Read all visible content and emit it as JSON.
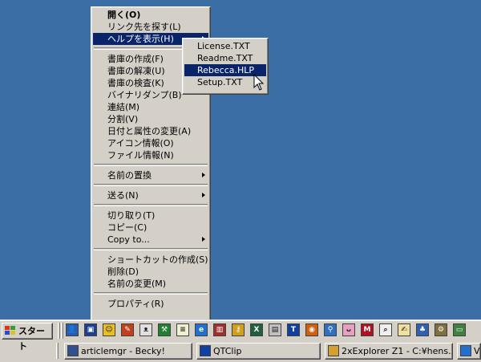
{
  "context_menu": {
    "items": [
      {
        "label": "開く(O)",
        "bold": true
      },
      {
        "label": "リンク先を探す(L)"
      },
      {
        "label": "ヘルプを表示(H)",
        "submenu": true,
        "selected": true
      },
      {
        "separator": true
      },
      {
        "label": "書庫の作成(F)"
      },
      {
        "label": "書庫の解凍(U)"
      },
      {
        "label": "書庫の検査(K)"
      },
      {
        "label": "バイナリダンプ(B)"
      },
      {
        "label": "連結(M)"
      },
      {
        "label": "分割(V)"
      },
      {
        "label": "日付と属性の変更(A)"
      },
      {
        "label": "アイコン情報(O)"
      },
      {
        "label": "ファイル情報(N)"
      },
      {
        "separator": true
      },
      {
        "label": "名前の置換",
        "submenu": true
      },
      {
        "separator": true
      },
      {
        "label": "送る(N)",
        "submenu": true
      },
      {
        "separator": true
      },
      {
        "label": "切り取り(T)"
      },
      {
        "label": "コピー(C)"
      },
      {
        "label": "Copy to...",
        "submenu": true
      },
      {
        "separator": true
      },
      {
        "label": "ショートカットの作成(S)"
      },
      {
        "label": "削除(D)"
      },
      {
        "label": "名前の変更(M)"
      },
      {
        "separator": true
      },
      {
        "label": "プロパティ(R)"
      }
    ]
  },
  "help_submenu": {
    "items": [
      {
        "label": "License.TXT"
      },
      {
        "label": "Readme.TXT"
      },
      {
        "label": "Rebecca.HLP",
        "selected": true
      },
      {
        "label": "Setup.TXT"
      }
    ]
  },
  "taskbar": {
    "start_label": "スタート",
    "quick_launch": [
      {
        "icon": "user-icon",
        "color": "#2a5db0",
        "glyph": "👤"
      },
      {
        "icon": "computer-icon",
        "color": "#1c3f94",
        "glyph": "▣"
      },
      {
        "icon": "smiley-icon",
        "color": "#e8c020",
        "glyph": "☺"
      },
      {
        "icon": "paint-icon",
        "color": "#c04020",
        "glyph": "✎"
      },
      {
        "icon": "cat-icon",
        "color": "#e0e0e0",
        "glyph": "ᴥ"
      },
      {
        "icon": "tool-icon",
        "color": "#208030",
        "glyph": "⚒"
      },
      {
        "icon": "notepad-icon",
        "color": "#f0f0d0",
        "glyph": "≡"
      },
      {
        "icon": "ie-icon",
        "color": "#2070d0",
        "glyph": "e"
      },
      {
        "icon": "books-icon",
        "color": "#a03030",
        "glyph": "▥"
      },
      {
        "icon": "key-icon",
        "color": "#d0a020",
        "glyph": "⚷"
      },
      {
        "icon": "x-icon",
        "color": "#206040",
        "glyph": "X"
      },
      {
        "icon": "clipboard-icon",
        "color": "#c0c0c0",
        "glyph": "▤"
      },
      {
        "icon": "t-icon",
        "color": "#1040a0",
        "glyph": "T"
      },
      {
        "icon": "media-icon",
        "color": "#d06010",
        "glyph": "◉"
      },
      {
        "icon": "search-icon",
        "color": "#3070c0",
        "glyph": "⚲"
      },
      {
        "icon": "cow-icon",
        "color": "#e8a0c0",
        "glyph": "ᴗ"
      },
      {
        "icon": "m-icon",
        "color": "#b01020",
        "glyph": "M"
      },
      {
        "icon": "find-icon",
        "color": "#f0f0f0",
        "glyph": "⌕"
      },
      {
        "icon": "edit-icon",
        "color": "#f0e0a0",
        "glyph": "✍"
      },
      {
        "icon": "tree-icon",
        "color": "#3060b0",
        "glyph": "♣"
      },
      {
        "icon": "gear-icon",
        "color": "#807040",
        "glyph": "⚙"
      },
      {
        "icon": "monitor-icon",
        "color": "#408040",
        "glyph": "▭"
      }
    ],
    "tasks": [
      {
        "label": "articlemgr - Becky!",
        "icon": "mail-icon",
        "icon_color": "#305090"
      },
      {
        "label": "QTClip",
        "icon": "qtclip-icon",
        "icon_color": "#1040a0"
      },
      {
        "label": "2xExplorer Z1 - C:¥hens...",
        "icon": "explorer-icon",
        "icon_color": "#d0a030"
      },
      {
        "label": "V",
        "icon": "ie-icon",
        "icon_color": "#2070d0"
      }
    ]
  }
}
